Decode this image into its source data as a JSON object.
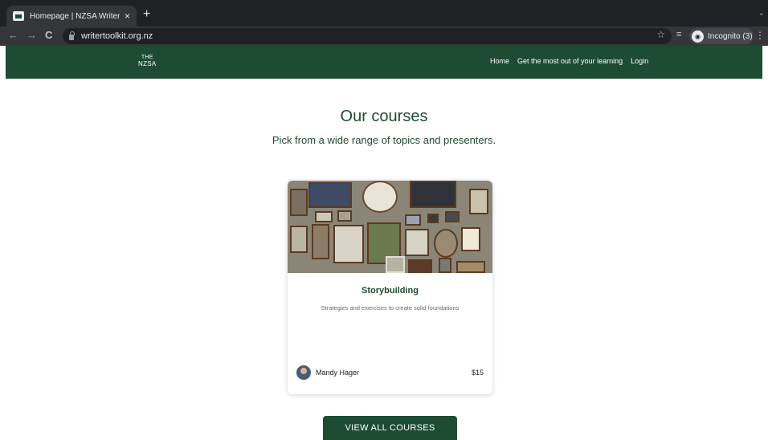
{
  "browser": {
    "tab_title": "Homepage | NZSA Writer Toolk",
    "close_glyph": "×",
    "new_tab_glyph": "+",
    "tab_menu_glyph": "⌄",
    "back_glyph": "←",
    "forward_glyph": "→",
    "reload_glyph": "C",
    "url": "writertoolkit.org.nz",
    "star_glyph": "☆",
    "reading_list_glyph": "≡",
    "incognito_label": "Incognito (3)",
    "menu_glyph": "⋮"
  },
  "site": {
    "logo_line1": "THE",
    "logo_line2": "NZSA",
    "nav": [
      {
        "label": "Home"
      },
      {
        "label": "Get the most out of your learning"
      },
      {
        "label": "Login"
      }
    ]
  },
  "main": {
    "heading": "Our courses",
    "subheading": "Pick from a wide range of topics and presenters."
  },
  "course": {
    "title": "Storybuilding",
    "description": "Strategies and exercises to create solid foundations",
    "presenter": "Mandy Hager",
    "price": "$15"
  },
  "cta_label": "VIEW ALL COURSES",
  "colors": {
    "brand_green": "#1e4c33",
    "chrome_dark": "#202124",
    "chrome_toolbar": "#35363a"
  },
  "icons": [
    "favicon-icon",
    "close-icon",
    "plus-icon",
    "back-icon",
    "forward-icon",
    "reload-icon",
    "lock-icon",
    "star-icon",
    "reading-list-icon",
    "incognito-icon",
    "kebab-menu-icon",
    "avatar"
  ]
}
